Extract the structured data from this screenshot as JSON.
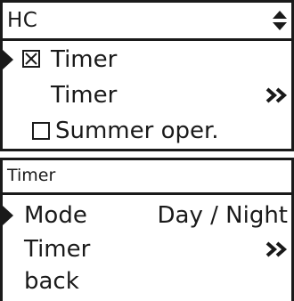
{
  "hc_menu": {
    "title": "HC",
    "items": [
      {
        "label": "Timer",
        "checkbox": "checked",
        "selected": true
      },
      {
        "label": "Timer",
        "submenu": true
      },
      {
        "label": "Summer oper.",
        "checkbox": "unchecked"
      }
    ]
  },
  "timer_menu": {
    "title": "Timer",
    "items": [
      {
        "label": "Mode",
        "value": "Day / Night",
        "selected": true
      },
      {
        "label": "Timer",
        "submenu": true
      },
      {
        "label": "back"
      }
    ]
  },
  "icons": {
    "scroll": "up-down-arrows-icon",
    "cursor": "selection-cursor-icon",
    "submenu": "double-chevron-right-icon",
    "checked": "checkbox-checked-icon",
    "unchecked": "checkbox-unchecked-icon"
  },
  "colors": {
    "foreground": "#1a1a1a",
    "background": "#ffffff"
  }
}
